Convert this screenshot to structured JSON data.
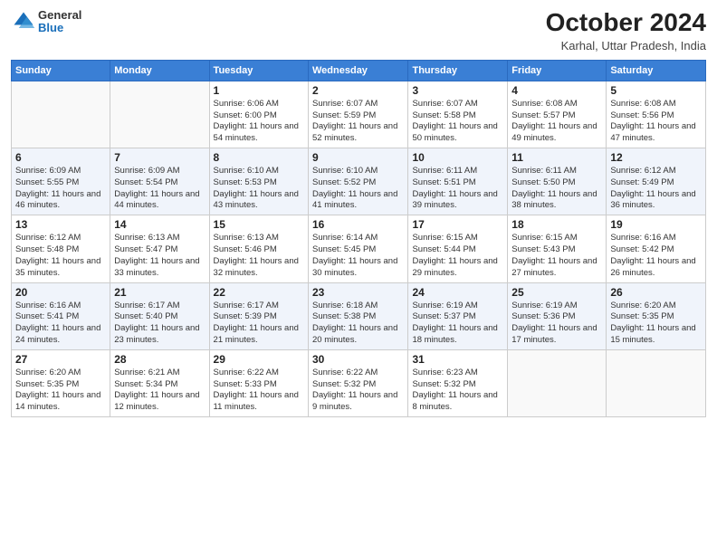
{
  "logo": {
    "general": "General",
    "blue": "Blue"
  },
  "header": {
    "month": "October 2024",
    "location": "Karhal, Uttar Pradesh, India"
  },
  "weekdays": [
    "Sunday",
    "Monday",
    "Tuesday",
    "Wednesday",
    "Thursday",
    "Friday",
    "Saturday"
  ],
  "weeks": [
    [
      {
        "day": "",
        "info": ""
      },
      {
        "day": "",
        "info": ""
      },
      {
        "day": "1",
        "info": "Sunrise: 6:06 AM\nSunset: 6:00 PM\nDaylight: 11 hours and 54 minutes."
      },
      {
        "day": "2",
        "info": "Sunrise: 6:07 AM\nSunset: 5:59 PM\nDaylight: 11 hours and 52 minutes."
      },
      {
        "day": "3",
        "info": "Sunrise: 6:07 AM\nSunset: 5:58 PM\nDaylight: 11 hours and 50 minutes."
      },
      {
        "day": "4",
        "info": "Sunrise: 6:08 AM\nSunset: 5:57 PM\nDaylight: 11 hours and 49 minutes."
      },
      {
        "day": "5",
        "info": "Sunrise: 6:08 AM\nSunset: 5:56 PM\nDaylight: 11 hours and 47 minutes."
      }
    ],
    [
      {
        "day": "6",
        "info": "Sunrise: 6:09 AM\nSunset: 5:55 PM\nDaylight: 11 hours and 46 minutes."
      },
      {
        "day": "7",
        "info": "Sunrise: 6:09 AM\nSunset: 5:54 PM\nDaylight: 11 hours and 44 minutes."
      },
      {
        "day": "8",
        "info": "Sunrise: 6:10 AM\nSunset: 5:53 PM\nDaylight: 11 hours and 43 minutes."
      },
      {
        "day": "9",
        "info": "Sunrise: 6:10 AM\nSunset: 5:52 PM\nDaylight: 11 hours and 41 minutes."
      },
      {
        "day": "10",
        "info": "Sunrise: 6:11 AM\nSunset: 5:51 PM\nDaylight: 11 hours and 39 minutes."
      },
      {
        "day": "11",
        "info": "Sunrise: 6:11 AM\nSunset: 5:50 PM\nDaylight: 11 hours and 38 minutes."
      },
      {
        "day": "12",
        "info": "Sunrise: 6:12 AM\nSunset: 5:49 PM\nDaylight: 11 hours and 36 minutes."
      }
    ],
    [
      {
        "day": "13",
        "info": "Sunrise: 6:12 AM\nSunset: 5:48 PM\nDaylight: 11 hours and 35 minutes."
      },
      {
        "day": "14",
        "info": "Sunrise: 6:13 AM\nSunset: 5:47 PM\nDaylight: 11 hours and 33 minutes."
      },
      {
        "day": "15",
        "info": "Sunrise: 6:13 AM\nSunset: 5:46 PM\nDaylight: 11 hours and 32 minutes."
      },
      {
        "day": "16",
        "info": "Sunrise: 6:14 AM\nSunset: 5:45 PM\nDaylight: 11 hours and 30 minutes."
      },
      {
        "day": "17",
        "info": "Sunrise: 6:15 AM\nSunset: 5:44 PM\nDaylight: 11 hours and 29 minutes."
      },
      {
        "day": "18",
        "info": "Sunrise: 6:15 AM\nSunset: 5:43 PM\nDaylight: 11 hours and 27 minutes."
      },
      {
        "day": "19",
        "info": "Sunrise: 6:16 AM\nSunset: 5:42 PM\nDaylight: 11 hours and 26 minutes."
      }
    ],
    [
      {
        "day": "20",
        "info": "Sunrise: 6:16 AM\nSunset: 5:41 PM\nDaylight: 11 hours and 24 minutes."
      },
      {
        "day": "21",
        "info": "Sunrise: 6:17 AM\nSunset: 5:40 PM\nDaylight: 11 hours and 23 minutes."
      },
      {
        "day": "22",
        "info": "Sunrise: 6:17 AM\nSunset: 5:39 PM\nDaylight: 11 hours and 21 minutes."
      },
      {
        "day": "23",
        "info": "Sunrise: 6:18 AM\nSunset: 5:38 PM\nDaylight: 11 hours and 20 minutes."
      },
      {
        "day": "24",
        "info": "Sunrise: 6:19 AM\nSunset: 5:37 PM\nDaylight: 11 hours and 18 minutes."
      },
      {
        "day": "25",
        "info": "Sunrise: 6:19 AM\nSunset: 5:36 PM\nDaylight: 11 hours and 17 minutes."
      },
      {
        "day": "26",
        "info": "Sunrise: 6:20 AM\nSunset: 5:35 PM\nDaylight: 11 hours and 15 minutes."
      }
    ],
    [
      {
        "day": "27",
        "info": "Sunrise: 6:20 AM\nSunset: 5:35 PM\nDaylight: 11 hours and 14 minutes."
      },
      {
        "day": "28",
        "info": "Sunrise: 6:21 AM\nSunset: 5:34 PM\nDaylight: 11 hours and 12 minutes."
      },
      {
        "day": "29",
        "info": "Sunrise: 6:22 AM\nSunset: 5:33 PM\nDaylight: 11 hours and 11 minutes."
      },
      {
        "day": "30",
        "info": "Sunrise: 6:22 AM\nSunset: 5:32 PM\nDaylight: 11 hours and 9 minutes."
      },
      {
        "day": "31",
        "info": "Sunrise: 6:23 AM\nSunset: 5:32 PM\nDaylight: 11 hours and 8 minutes."
      },
      {
        "day": "",
        "info": ""
      },
      {
        "day": "",
        "info": ""
      }
    ]
  ]
}
